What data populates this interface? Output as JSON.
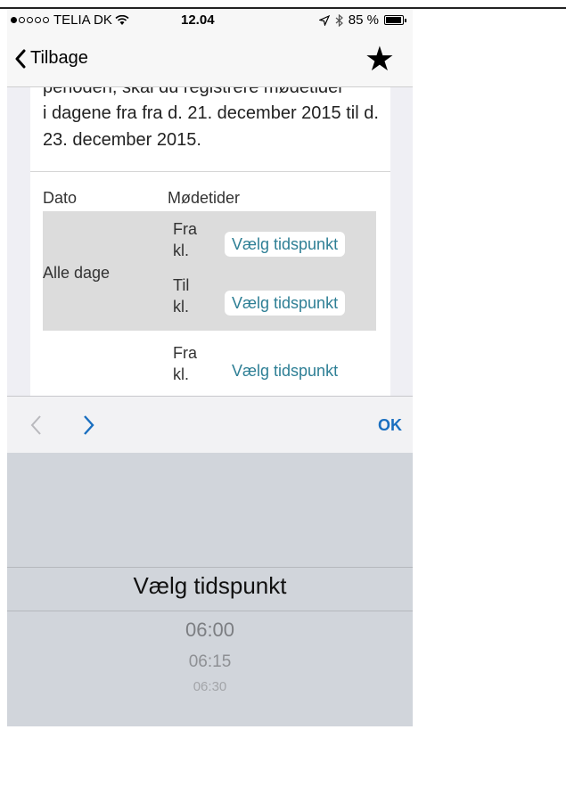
{
  "status_bar": {
    "carrier": "TELIA DK",
    "time": "12.04",
    "battery": "85 %"
  },
  "nav": {
    "back_label": "Tilbage"
  },
  "content": {
    "cut_text": "perioden, skal du registrere mødetider",
    "intro": "i dagene fra fra d. 21. december 2015 til d. 23. december 2015.",
    "headers": {
      "date": "Dato",
      "times": "Mødetider"
    },
    "rows": [
      {
        "date": "Alle dage",
        "from_label": "Fra kl.",
        "from_value": "Vælg tidspunkt",
        "to_label": "Til kl.",
        "to_value": "Vælg tidspunkt"
      },
      {
        "from_label": "Fra kl.",
        "from_value": "Vælg tidspunkt"
      }
    ]
  },
  "toolbar": {
    "done_label": "OK"
  },
  "picker": {
    "selected": "Vælg tidspunkt",
    "options": [
      "06:00",
      "06:15",
      "06:30"
    ]
  }
}
